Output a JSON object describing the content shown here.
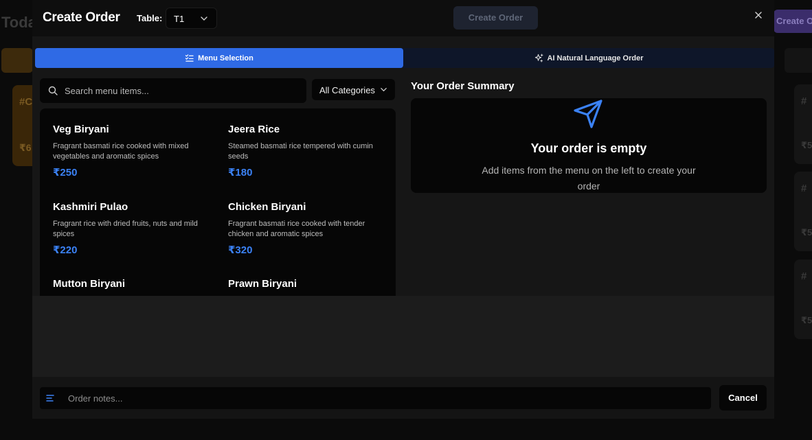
{
  "background": {
    "page_title": "Toda",
    "top_button": "Create O",
    "left_card": {
      "id": "#C",
      "amount": "₹6"
    },
    "right_cards": [
      {
        "id": "#",
        "amount": "₹5"
      },
      {
        "id": "#",
        "amount": "₹5"
      },
      {
        "id": "#",
        "amount": "₹5"
      }
    ]
  },
  "modal": {
    "title": "Create Order",
    "table_label": "Table:",
    "table_value": "T1",
    "create_button": "Create Order",
    "close_icon": "×"
  },
  "tabs": [
    {
      "label": "Menu Selection",
      "icon": "list-check-icon",
      "active": true
    },
    {
      "label": "AI Natural Language Order",
      "icon": "sparkles-icon",
      "active": false
    }
  ],
  "search": {
    "placeholder": "Search menu items..."
  },
  "category_select": {
    "value": "All Categories"
  },
  "menu_items": [
    {
      "name": "Veg Biryani",
      "description": "Fragrant basmati rice cooked with mixed vegetables and aromatic spices",
      "price": "₹250"
    },
    {
      "name": "Jeera Rice",
      "description": "Steamed basmati rice tempered with cumin seeds",
      "price": "₹180"
    },
    {
      "name": "Kashmiri Pulao",
      "description": "Fragrant rice with dried fruits, nuts and mild spices",
      "price": "₹220"
    },
    {
      "name": "Chicken Biryani",
      "description": "Fragrant basmati rice cooked with tender chicken and aromatic spices",
      "price": "₹320"
    },
    {
      "name": "Mutton Biryani",
      "description": "",
      "price": ""
    },
    {
      "name": "Prawn Biryani",
      "description": "",
      "price": ""
    }
  ],
  "summary": {
    "title": "Your Order Summary",
    "empty_title": "Your order is empty",
    "empty_message": "Add items from the menu on the left to create your order"
  },
  "footer": {
    "notes_placeholder": "Order notes...",
    "cancel_button": "Cancel"
  },
  "colors": {
    "accent": "#2f6ae5",
    "price": "#3b82f6",
    "modal_bg": "#161616"
  }
}
